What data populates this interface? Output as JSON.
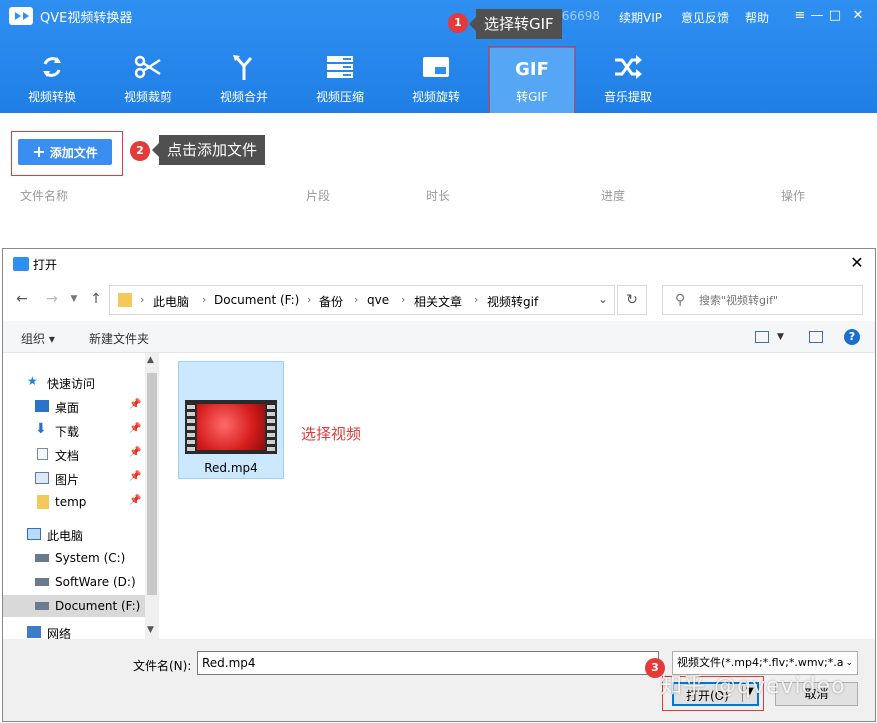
{
  "app": {
    "title": "QVE视频转换器",
    "phone_partial": "13492566698",
    "links": [
      "续期VIP",
      "意见反馈",
      "帮助"
    ],
    "window_controls": [
      "≡",
      "—",
      "□",
      "✕"
    ],
    "brand_color": "#2f8ff1"
  },
  "toolbar": {
    "items": [
      {
        "label": "视频转换",
        "icon": "refresh-icon"
      },
      {
        "label": "视频裁剪",
        "icon": "scissors-icon"
      },
      {
        "label": "视频合并",
        "icon": "merge-icon"
      },
      {
        "label": "视频压缩",
        "icon": "compress-icon"
      },
      {
        "label": "视频旋转",
        "icon": "rotate-icon"
      },
      {
        "label": "转GIF",
        "icon": "gif-icon",
        "gif_text": "GIF",
        "active": true
      },
      {
        "label": "音乐提取",
        "icon": "shuffle-icon"
      }
    ]
  },
  "annotations": {
    "step1_num": "1",
    "step1_text": "选择转GIF",
    "step2_num": "2",
    "step2_text": "点击添加文件",
    "step3_num": "3",
    "select_video": "选择视频"
  },
  "content": {
    "add_file_icon": "+",
    "add_file_label": "添加文件",
    "columns": [
      "文件名称",
      "片段",
      "时长",
      "进度",
      "操作"
    ]
  },
  "dialog": {
    "title": "打开",
    "close": "✕",
    "breadcrumb": [
      "此电脑",
      "Document (F:)",
      "备份",
      "qve",
      "相关文章",
      "视频转gif"
    ],
    "search_placeholder": "搜索\"视频转gif\"",
    "commands": {
      "organize": "组织 ▾",
      "new_folder": "新建文件夹",
      "help": "?"
    },
    "nav": [
      {
        "label": "快速访问",
        "icon": "star-icon",
        "pinned": false
      },
      {
        "label": "桌面",
        "icon": "desktop-icon",
        "pinned": true
      },
      {
        "label": "下载",
        "icon": "download-icon",
        "pinned": true
      },
      {
        "label": "文档",
        "icon": "document-icon",
        "pinned": true
      },
      {
        "label": "图片",
        "icon": "picture-icon",
        "pinned": true
      },
      {
        "label": "temp",
        "icon": "folder-icon",
        "pinned": true
      },
      {
        "label": "此电脑",
        "icon": "computer-icon",
        "pinned": false
      },
      {
        "label": "System (C:)",
        "icon": "drive-icon",
        "pinned": false
      },
      {
        "label": "SoftWare (D:)",
        "icon": "drive-icon",
        "pinned": false
      },
      {
        "label": "Document (F:)",
        "icon": "drive-icon",
        "pinned": false,
        "selected": true
      },
      {
        "label": "网络",
        "icon": "network-icon",
        "pinned": false
      }
    ],
    "file": {
      "name": "Red.mp4"
    },
    "filename_label": "文件名(N):",
    "filename_value": "Red.mp4",
    "file_type": "视频文件(*.mp4;*.flv;*.wmv;*.a",
    "open_label": "打开(O)",
    "cancel_label": "取消"
  },
  "watermark": "知乎 @qvevideo"
}
